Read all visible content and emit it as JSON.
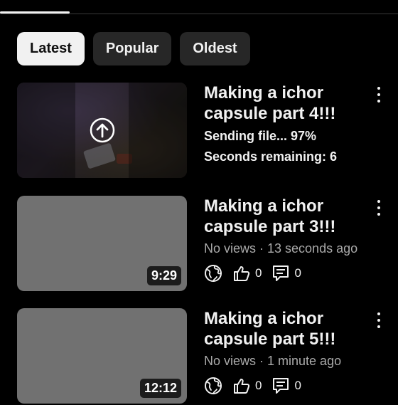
{
  "filters": [
    "Latest",
    "Popular",
    "Oldest"
  ],
  "active_filter": "Latest",
  "videos": [
    {
      "title_lines": [
        "Making a ichor",
        "capsule part 4!!!"
      ],
      "state": "uploading",
      "upload_status": "Sending file... 97%",
      "upload_progress": 0.97,
      "remaining": "Seconds remaining: 6",
      "thumbnail_icon": "upload-arrow-icon"
    },
    {
      "title_lines": [
        "Making a ichor",
        "capsule part 3!!!"
      ],
      "state": "published",
      "duration": "9:29",
      "meta": "No views · 13 seconds ago",
      "likes": "0",
      "comments": "0",
      "visibility_icon": "globe-icon"
    },
    {
      "title_lines": [
        "Making a ichor",
        "capsule part 5!!!"
      ],
      "state": "published",
      "duration": "12:12",
      "meta": "No views · 1 minute ago",
      "likes": "0",
      "comments": "0",
      "visibility_icon": "globe-icon"
    }
  ],
  "colors": {
    "background": "#000000",
    "chip_active_bg": "#f1f1f1",
    "chip_bg": "#272727",
    "thumbnail_placeholder": "#717171",
    "secondary_text": "#aaaaaa"
  }
}
